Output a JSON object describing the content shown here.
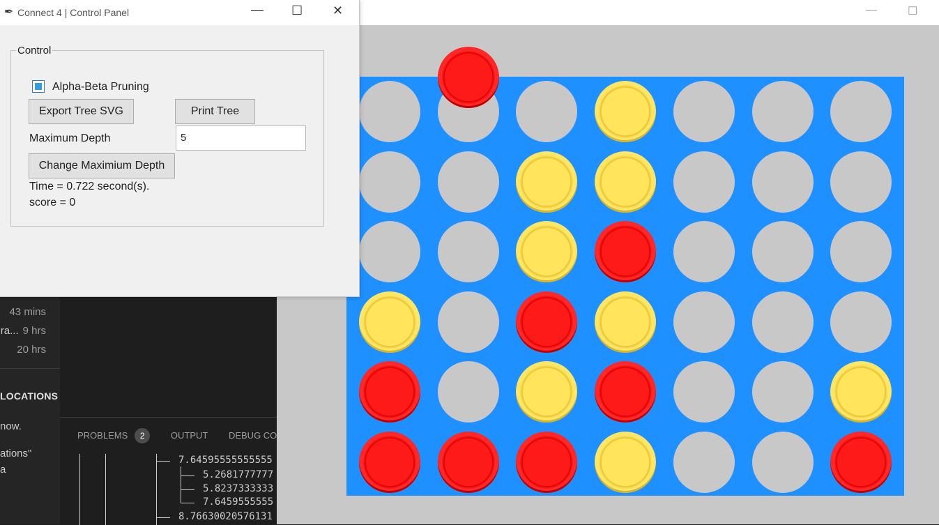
{
  "control_panel": {
    "title": "Connect 4 | Control Panel",
    "group_label": "Control",
    "pruning_label": "Alpha-Beta Pruning",
    "pruning_checked": true,
    "export_button": "Export Tree SVG",
    "print_button": "Print Tree",
    "depth_label": "Maximum Depth",
    "depth_value": "5",
    "change_depth_button": "Change Maximium Depth",
    "time_text": "Time = 0.722 second(s).",
    "score_text": "score = 0"
  },
  "board": {
    "rows": 6,
    "cols": 7,
    "colors": {
      "board": "#1e90ff",
      "empty": "#c8c8c8",
      "red": "#ff1a1a",
      "yellow": "#ffe45c",
      "background": "#c8c8c8"
    },
    "hover_piece": {
      "color": "red",
      "column": 1
    },
    "grid": [
      [
        "empty",
        "empty",
        "empty",
        "yellow",
        "empty",
        "empty",
        "empty"
      ],
      [
        "empty",
        "empty",
        "yellow",
        "yellow",
        "empty",
        "empty",
        "empty"
      ],
      [
        "empty",
        "empty",
        "yellow",
        "red",
        "empty",
        "empty",
        "empty"
      ],
      [
        "yellow",
        "empty",
        "red",
        "yellow",
        "empty",
        "empty",
        "empty"
      ],
      [
        "red",
        "empty",
        "yellow",
        "red",
        "empty",
        "empty",
        "yellow"
      ],
      [
        "red",
        "red",
        "red",
        "yellow",
        "empty",
        "empty",
        "red"
      ]
    ]
  },
  "vscode": {
    "recent_times": [
      "43 mins",
      "9 hrs",
      "20 hrs"
    ],
    "recent_prefix": "ra...",
    "locations_title": "LOCATIONS",
    "locations_lines": [
      "now.",
      "ations\"",
      "a"
    ],
    "panel_tabs": {
      "problems": "PROBLEMS",
      "problems_count": "2",
      "output": "OUTPUT",
      "debug": "DEBUG CON"
    },
    "terminal_lines": [
      "7.64595555555555",
      "5.2681777777",
      "5.8237333333",
      "7.6459555555",
      "8.76630020576131"
    ]
  }
}
